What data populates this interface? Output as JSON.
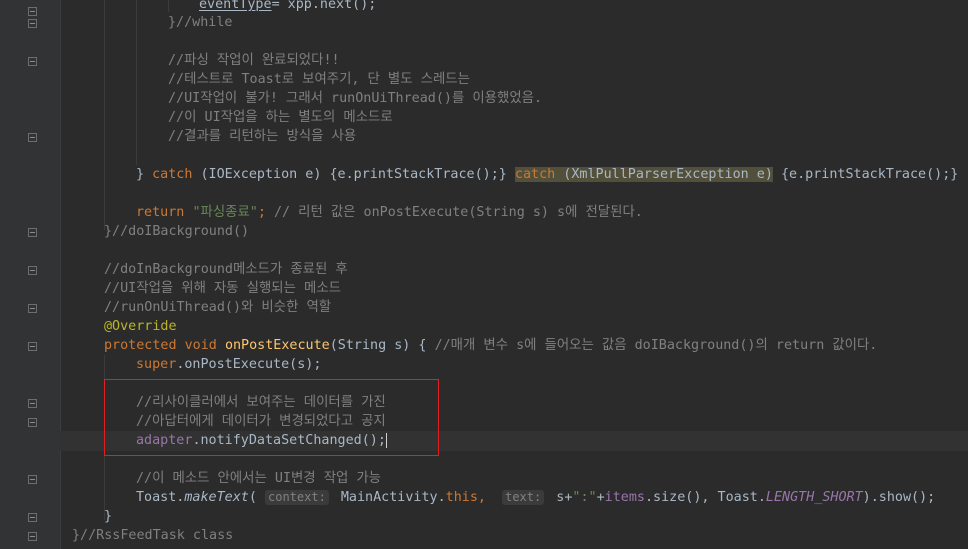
{
  "editor": {
    "lines": {
      "l01": [
        "eventType",
        "= xpp.next();"
      ],
      "l02": "}//while",
      "l03": "//파싱 작업이 완료되었다!!",
      "l04": "//테스트로 Toast로 보여주기, 단 별도 스레드는",
      "l05": "//UI작업이 불가! 그래서 runOnUiThread()를 이용했었음.",
      "l06": "//이 UI작업을 하는 별도의 메소드로",
      "l07": "//결과를 리턴하는 방식을 사용",
      "l08": {
        "brace": "} ",
        "catch1": "catch",
        "args1": " (IOException e) {e.printStackTrace();} ",
        "catch2": "catch",
        "args2": " (XmlPullParserException e)",
        "rest": " {e.printStackTrace();}"
      },
      "l09": {
        "ret": "return ",
        "str": "\"파싱종료\"",
        "semi": "; ",
        "comment": "// 리턴 값은 onPostExecute(String s) s에 전달된다."
      },
      "l10": "}//doIBackground()",
      "l11": "//doInBackground메소드가 종료된 후",
      "l12": "//UI작업을 위해 자동 실행되는 메소드",
      "l13": "//runOnUiThread()와 비슷한 역할",
      "l14": "@Override",
      "l15": {
        "mod": "protected void ",
        "name": "onPostExecute",
        "params": "(String s) { ",
        "comment": "//매개 변수 s에 들어오는 값음 doIBackground()의 return 값이다."
      },
      "l16": {
        "sup": "super",
        "rest": ".onPostExecute(s);"
      },
      "l17": "//리사이클러에서 보여주는 데이터를 가진",
      "l18": "//아답터에게 데이터가 변경되었다고 공지",
      "l19": {
        "field": "adapter",
        "rest": ".notifyDataSetChanged();"
      },
      "l20": "//이 메소드 안에서는 UI변경 작업 가능",
      "l21": {
        "cls": "Toast.",
        "method": "makeText",
        "open": "( ",
        "hint1": "context:",
        "arg1": " MainActivity.",
        "this": "this",
        "comma": ",  ",
        "hint2": "text:",
        "arg2a": " s+",
        "arg2s": "\":\"",
        "arg2b": "+",
        "items": "items",
        "arg2c": ".size(), Toast.",
        "const": "LENGTH_SHORT",
        "close": ").show();"
      },
      "l22": "}",
      "l23": "}//RssFeedTask class"
    }
  },
  "colors": {
    "background": "#2b2b2b",
    "keyword": "#cc7832",
    "comment": "#808080",
    "string": "#6a8759",
    "annotation": "#bbb529",
    "method": "#ffc66d",
    "field": "#9876aa",
    "highlight_box": "#e02020"
  }
}
